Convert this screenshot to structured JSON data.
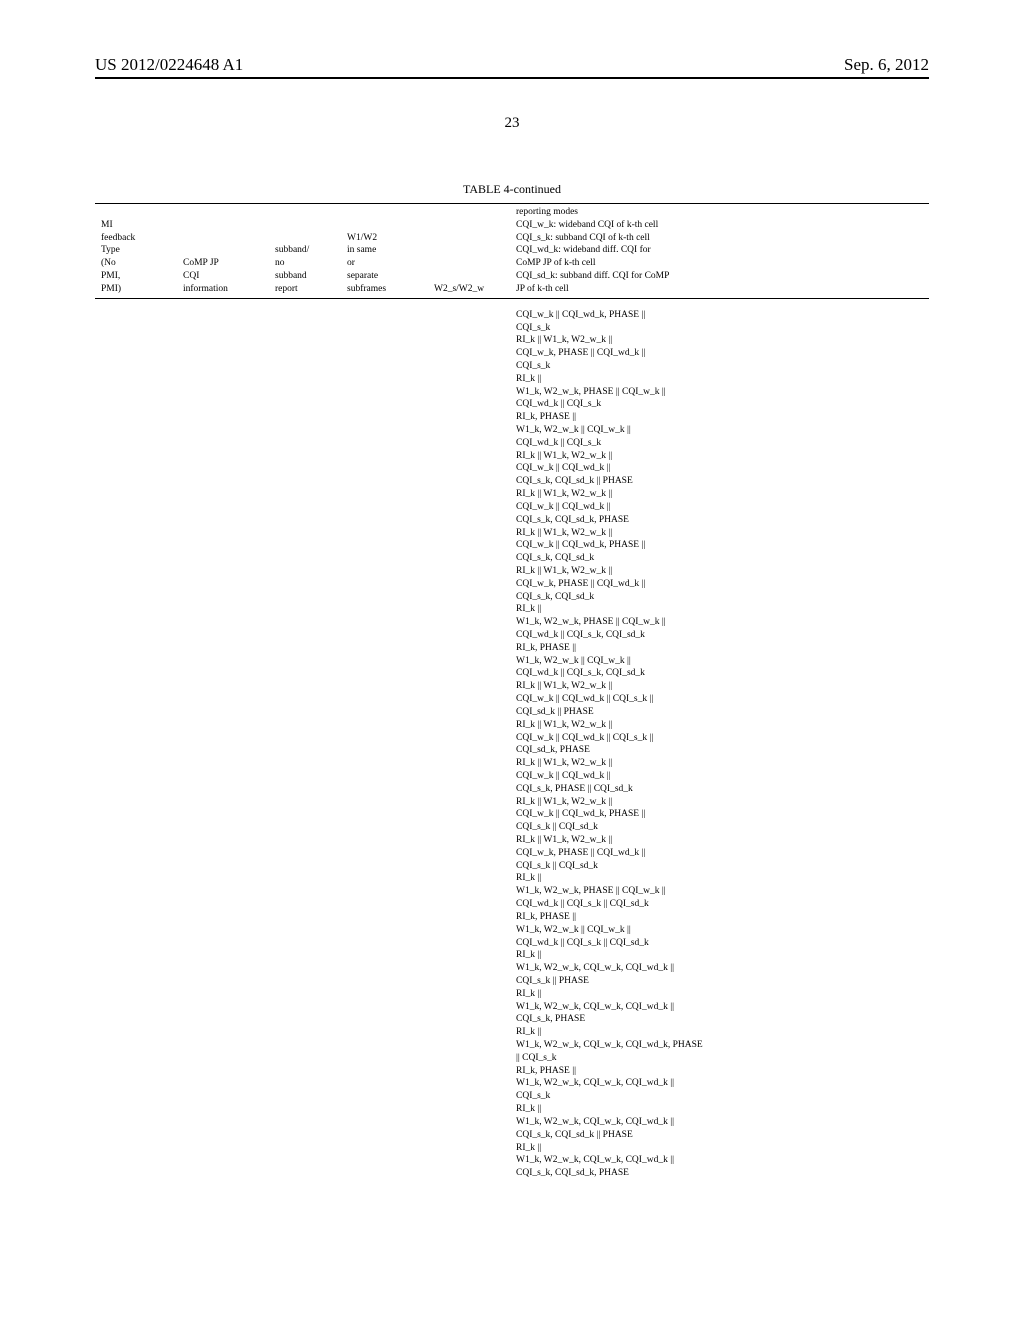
{
  "header": {
    "left": "US 2012/0224648 A1",
    "right": "Sep. 6, 2012"
  },
  "page_number": "23",
  "table": {
    "title": "TABLE 4-continued",
    "columns": {
      "c1": "MI\nfeedback\nType\n(No\nPMI,\nPMI)",
      "c2": "CoMP JP\nCQI\ninformation",
      "c3": "subband/\nno\nsubband\nreport",
      "c4": "W1/W2\nin same\nor\nseparate\nsubframes",
      "c5": "W2_s/W2_w",
      "c6": "reporting modes\nCQI_w_k: wideband CQI of k-th cell\nCQI_s_k: subband CQI of k-th cell\nCQI_wd_k: wideband diff. CQI for\nCoMP JP of k-th cell\nCQI_sd_k: subband diff. CQI for CoMP\nJP of k-th cell"
    },
    "body_notes": "CQI_w_k || CQI_wd_k, PHASE ||\nCQI_s_k\nRI_k || W1_k, W2_w_k ||\nCQI_w_k, PHASE || CQI_wd_k ||\nCQI_s_k\nRI_k ||\nW1_k, W2_w_k, PHASE || CQI_w_k ||\nCQI_wd_k || CQI_s_k\nRI_k, PHASE ||\nW1_k, W2_w_k || CQI_w_k ||\nCQI_wd_k || CQI_s_k\nRI_k || W1_k, W2_w_k ||\nCQI_w_k || CQI_wd_k ||\nCQI_s_k, CQI_sd_k || PHASE\nRI_k || W1_k, W2_w_k ||\nCQI_w_k || CQI_wd_k ||\nCQI_s_k, CQI_sd_k, PHASE\nRI_k || W1_k, W2_w_k ||\nCQI_w_k || CQI_wd_k, PHASE ||\nCQI_s_k, CQI_sd_k\nRI_k || W1_k, W2_w_k ||\nCQI_w_k, PHASE || CQI_wd_k ||\nCQI_s_k, CQI_sd_k\nRI_k ||\nW1_k, W2_w_k, PHASE || CQI_w_k ||\nCQI_wd_k || CQI_s_k, CQI_sd_k\nRI_k, PHASE ||\nW1_k, W2_w_k || CQI_w_k ||\nCQI_wd_k || CQI_s_k, CQI_sd_k\nRI_k || W1_k, W2_w_k ||\nCQI_w_k || CQI_wd_k || CQI_s_k ||\nCQI_sd_k || PHASE\nRI_k || W1_k, W2_w_k ||\nCQI_w_k || CQI_wd_k || CQI_s_k ||\nCQI_sd_k, PHASE\nRI_k || W1_k, W2_w_k ||\nCQI_w_k || CQI_wd_k ||\nCQI_s_k, PHASE || CQI_sd_k\nRI_k || W1_k, W2_w_k ||\nCQI_w_k || CQI_wd_k, PHASE ||\nCQI_s_k || CQI_sd_k\nRI_k || W1_k, W2_w_k ||\nCQI_w_k, PHASE || CQI_wd_k ||\nCQI_s_k || CQI_sd_k\nRI_k ||\nW1_k, W2_w_k, PHASE || CQI_w_k ||\nCQI_wd_k || CQI_s_k || CQI_sd_k\nRI_k, PHASE ||\nW1_k, W2_w_k || CQI_w_k ||\nCQI_wd_k || CQI_s_k || CQI_sd_k\nRI_k ||\nW1_k, W2_w_k, CQI_w_k, CQI_wd_k ||\nCQI_s_k || PHASE\nRI_k ||\nW1_k, W2_w_k, CQI_w_k, CQI_wd_k ||\nCQI_s_k, PHASE\nRI_k ||\nW1_k, W2_w_k, CQI_w_k, CQI_wd_k, PHASE\n|| CQI_s_k\nRI_k, PHASE ||\nW1_k, W2_w_k, CQI_w_k, CQI_wd_k ||\nCQI_s_k\nRI_k ||\nW1_k, W2_w_k, CQI_w_k, CQI_wd_k ||\nCQI_s_k, CQI_sd_k || PHASE\nRI_k ||\nW1_k, W2_w_k, CQI_w_k, CQI_wd_k ||\nCQI_s_k, CQI_sd_k, PHASE"
  }
}
